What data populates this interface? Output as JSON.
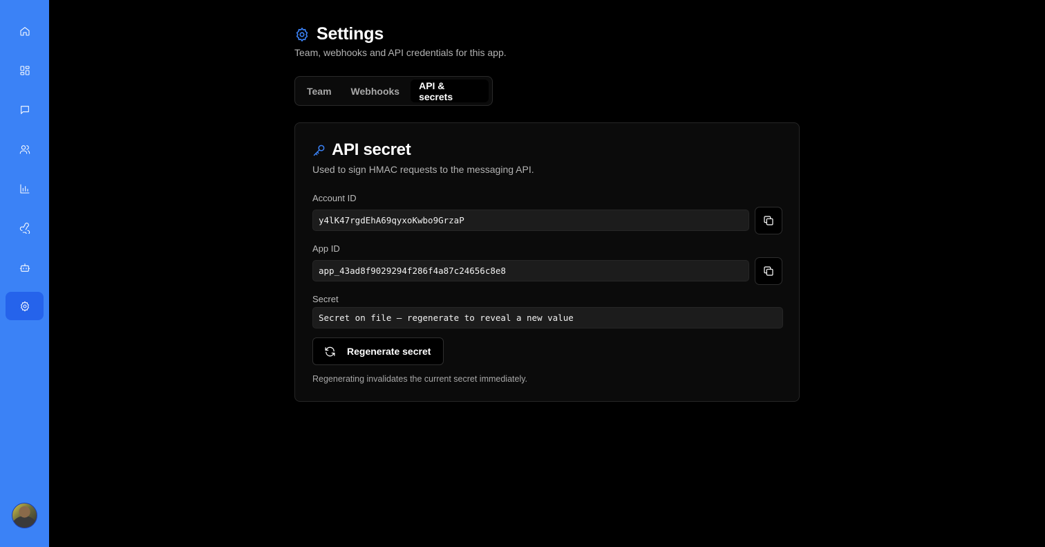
{
  "sidebar": {
    "items": [
      {
        "icon": "home-icon"
      },
      {
        "icon": "dashboard-icon"
      },
      {
        "icon": "chat-icon"
      },
      {
        "icon": "users-icon"
      },
      {
        "icon": "chart-icon"
      },
      {
        "icon": "webhook-icon"
      },
      {
        "icon": "bot-icon"
      },
      {
        "icon": "gear-icon",
        "active": true
      }
    ],
    "accent": "#3b82f6"
  },
  "header": {
    "title": "Settings",
    "subtitle": "Team, webhooks and API credentials for this app."
  },
  "tabs": [
    {
      "label": "Team"
    },
    {
      "label": "Webhooks"
    },
    {
      "label": "API & secrets",
      "active": true
    }
  ],
  "card": {
    "title": "API secret",
    "description": "Used to sign HMAC requests to the messaging API.",
    "account_id": {
      "label": "Account ID",
      "value": "y4lK47rgdEhA69qyxoKwbo9GrzaP"
    },
    "app_id": {
      "label": "App ID",
      "value": "app_43ad8f9029294f286f4a87c24656c8e8"
    },
    "secret": {
      "label": "Secret",
      "value": "Secret on file — regenerate to reveal a new value"
    },
    "regenerate_label": "Regenerate secret",
    "hint": "Regenerating invalidates the current secret immediately."
  }
}
